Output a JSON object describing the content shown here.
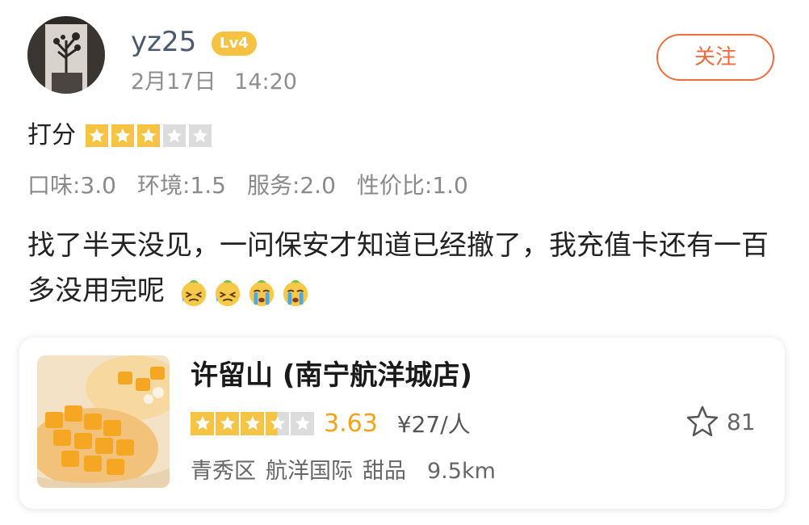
{
  "header": {
    "username": "yz25",
    "level": "Lv4",
    "post_date": "2月17日",
    "post_time": "14:20",
    "follow_label": "关注",
    "avatar_icon": "avatar-photo"
  },
  "rating": {
    "label": "打分",
    "stars": 3,
    "max_stars": 5,
    "sub_scores": [
      {
        "label": "口味:3.0"
      },
      {
        "label": "环境:1.5"
      },
      {
        "label": "服务:2.0"
      },
      {
        "label": "性价比:1.0"
      }
    ]
  },
  "review": {
    "text": "找了半天没见，一问保安才知道已经撤了，我充值卡还有一百多没用完呢",
    "emojis": [
      "sweat-face-icon",
      "sweat-face-icon",
      "crying-face-icon",
      "crying-face-icon"
    ]
  },
  "shop": {
    "name": "许留山 (南宁航洋城店)",
    "stars": 3.5,
    "score": "3.63",
    "price": "¥27/人",
    "district": "青秀区",
    "area": "航洋国际",
    "category": "甜品",
    "distance": "9.5km",
    "fav_count": "81",
    "thumb_icon": "mango-dessert-photo"
  },
  "colors": {
    "accent": "#f06b3f",
    "star": "#f6c444",
    "score": "#f2a21b",
    "badge": "#f5c242"
  }
}
